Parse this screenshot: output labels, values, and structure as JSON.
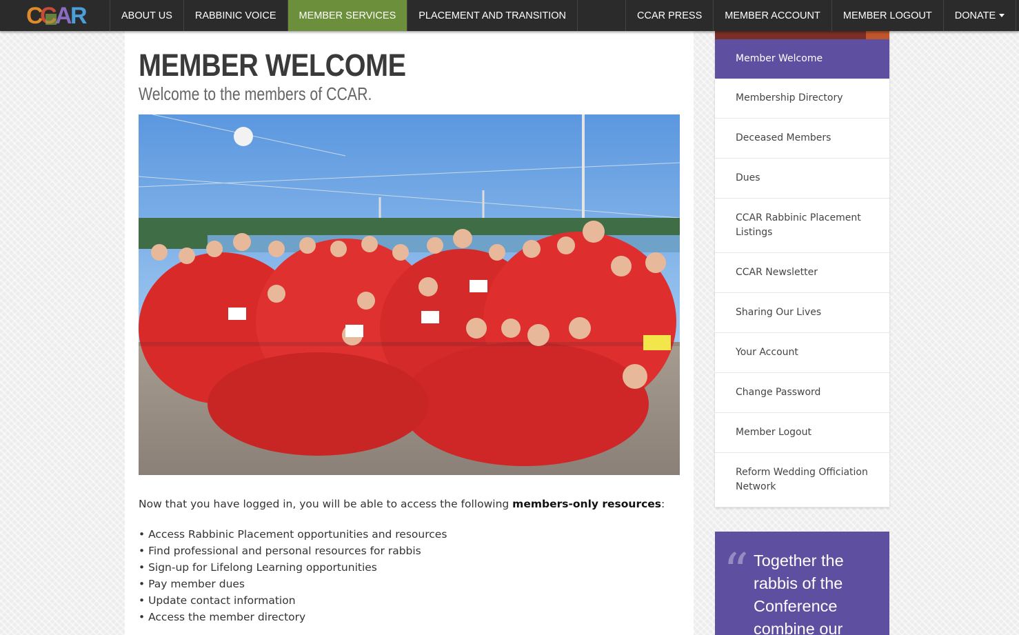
{
  "nav": {
    "logo_text": "CCAR",
    "left": [
      "ABOUT US",
      "RABBINIC VOICE",
      "MEMBER SERVICES",
      "PLACEMENT AND TRANSITION"
    ],
    "right": [
      "CCAR PRESS",
      "MEMBER ACCOUNT",
      "MEMBER LOGOUT",
      "DONATE"
    ],
    "active": "MEMBER SERVICES",
    "search_icon": "search-icon",
    "caret_icon": "chevron-down-icon"
  },
  "page": {
    "title": "MEMBER WELCOME",
    "subtitle": "Welcome to the members of CCAR.",
    "photo_icon": "group-photo",
    "intro_before": "Now that you have logged in, you will be able to access the following ",
    "intro_bold": "members-only resources",
    "intro_after": ":",
    "resources": [
      "• Access Rabbinic Placement opportunities and resources",
      "• Find professional and personal resources for rabbis",
      "• Sign-up for Lifelong Learning opportunities",
      "• Pay member dues",
      "• Update contact information",
      "• Access the member directory"
    ]
  },
  "sidebar": {
    "items": [
      "Member Welcome",
      "Membership Directory",
      "Deceased Members",
      "Dues",
      "CCAR Rabbinic Placement Listings",
      "CCAR Newsletter",
      "Sharing Our Lives",
      "Your Account",
      "Change Password",
      "Member Logout",
      "Reform Wedding Officiation Network"
    ],
    "active": "Member Welcome"
  },
  "quote": {
    "mark": "“",
    "text": "Together the rabbis of the Conference combine our"
  },
  "colors": {
    "nav_bg": "#2b2b2b",
    "nav_active": "#6c8f3c",
    "sidebar_active": "#5f4fa1",
    "quote_bg": "#5f4fa1",
    "sidebar_top": "#7a2f27",
    "logo": [
      "#e08a2c",
      "#c74b37",
      "#8a6cc0",
      "#4a9fd8",
      "#9bc24a"
    ]
  }
}
